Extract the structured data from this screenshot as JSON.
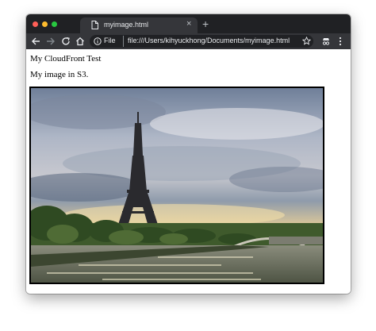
{
  "window": {
    "controls": [
      "close",
      "minimize",
      "zoom"
    ],
    "control_colors": {
      "close": "#ff5f57",
      "minimize": "#febc2e",
      "zoom": "#28c840"
    }
  },
  "tab": {
    "title": "myimage.html",
    "icon": "document-icon",
    "close_label": "×"
  },
  "new_tab_label": "+",
  "toolbar": {
    "back_icon": "back-arrow-icon",
    "forward_icon": "forward-arrow-icon",
    "reload_icon": "reload-icon",
    "home_icon": "home-icon",
    "info_icon": "info-icon",
    "scheme_label": "File",
    "url": "file:///Users/kihyuckhong/Documents/myimage.html",
    "star_icon": "star-icon",
    "incognito_icon": "incognito-icon",
    "menu_icon": "kebab-menu-icon"
  },
  "page": {
    "heading_text": "My CloudFront Test",
    "body_text": "My image in S3.",
    "image_subject": "Eiffel Tower at sunset over the Seine"
  },
  "colors": {
    "tabbar_bg": "#202124",
    "toolbar_bg": "#35363a",
    "omnibox_bg": "#202124",
    "page_bg": "#ffffff"
  }
}
